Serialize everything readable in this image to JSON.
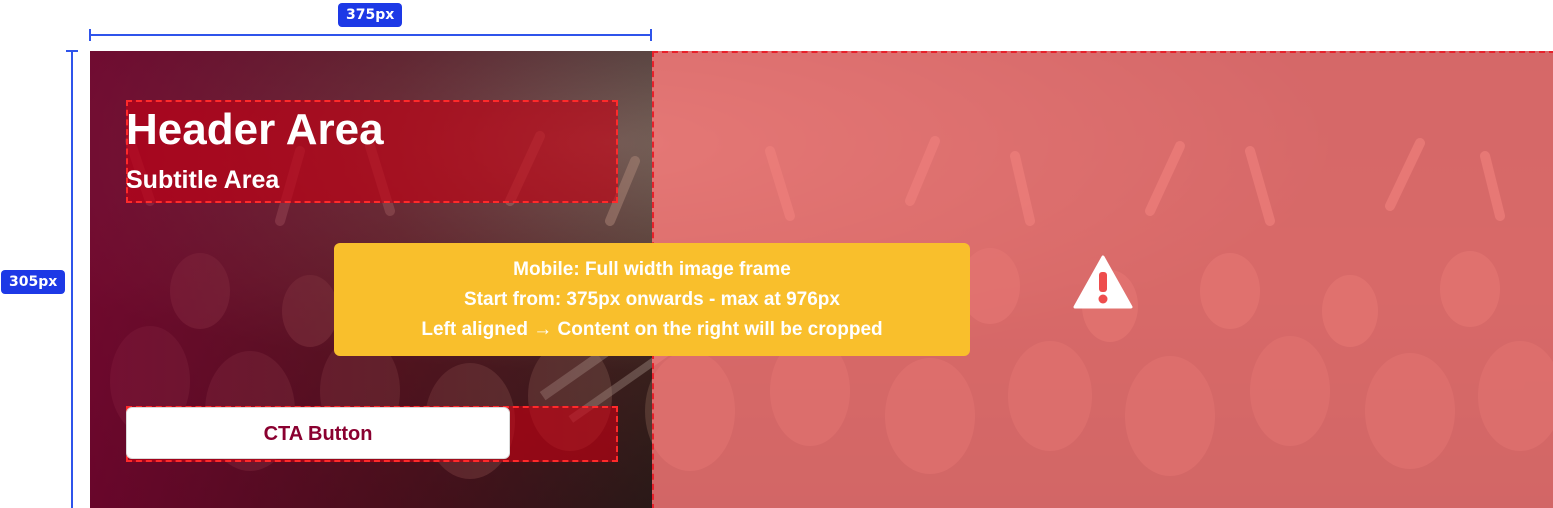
{
  "dimensions": {
    "width_label": "375px",
    "height_label": "305px"
  },
  "mobile_frame": {
    "header_title": "Header Area",
    "header_subtitle": "Subtitle Area",
    "cta_label": "CTA Button"
  },
  "note": {
    "lines": [
      "Mobile: Full width image frame",
      "Start from: 375px onwards - max at 976px",
      "Left aligned → Content on the right will be cropped"
    ]
  },
  "crop_zone": {
    "icon": "warning-icon"
  },
  "colors": {
    "measure_blue": "#1d39e6",
    "brand_crimson": "#8a0030",
    "crop_red": "#e8202a",
    "note_yellow": "#f9bf2c"
  }
}
